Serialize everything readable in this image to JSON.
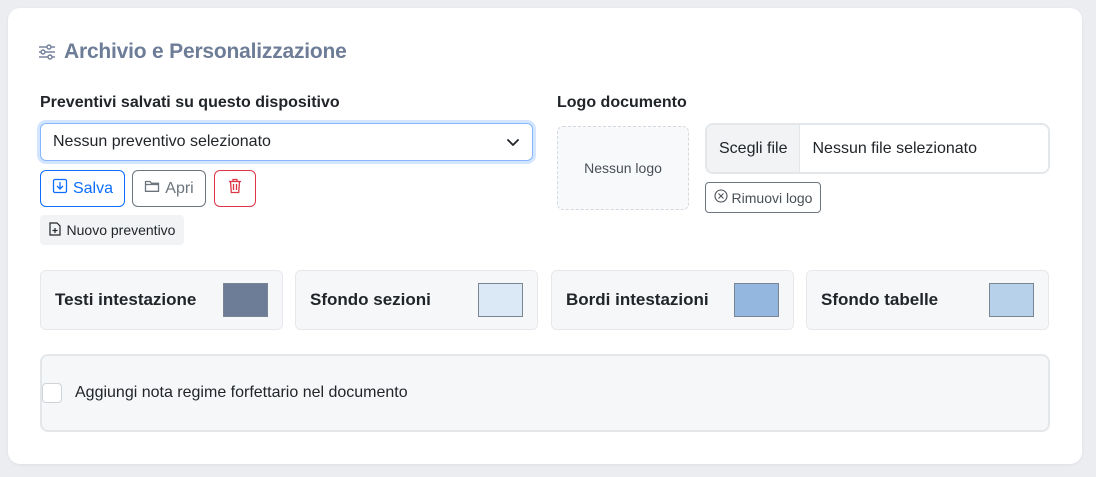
{
  "section": {
    "title": "Archivio e Personalizzazione",
    "icon": "sliders-icon"
  },
  "quotes": {
    "label": "Preventivi salvati su questo dispositivo",
    "select_value": "Nessun preventivo selezionato",
    "save_label": "Salva",
    "open_label": "Apri",
    "new_label": "Nuovo preventivo"
  },
  "logo": {
    "label": "Logo documento",
    "placeholder": "Nessun logo",
    "choose_file_label": "Scegli file",
    "file_status": "Nessun file selezionato",
    "remove_label": "Rimuovi logo"
  },
  "colors": [
    {
      "label": "Testi intestazione",
      "color": "#6e7d97"
    },
    {
      "label": "Sfondo sezioni",
      "color": "#dbe8f5"
    },
    {
      "label": "Bordi intestazioni",
      "color": "#93b7df"
    },
    {
      "label": "Sfondo tabelle",
      "color": "#b8d1ea"
    }
  ],
  "note": {
    "label": "Aggiungi nota regime forfettario nel documento",
    "checked": false
  },
  "theme": {
    "primary": "#0d6efd",
    "danger": "#dc3545",
    "secondary": "#6c757d"
  }
}
